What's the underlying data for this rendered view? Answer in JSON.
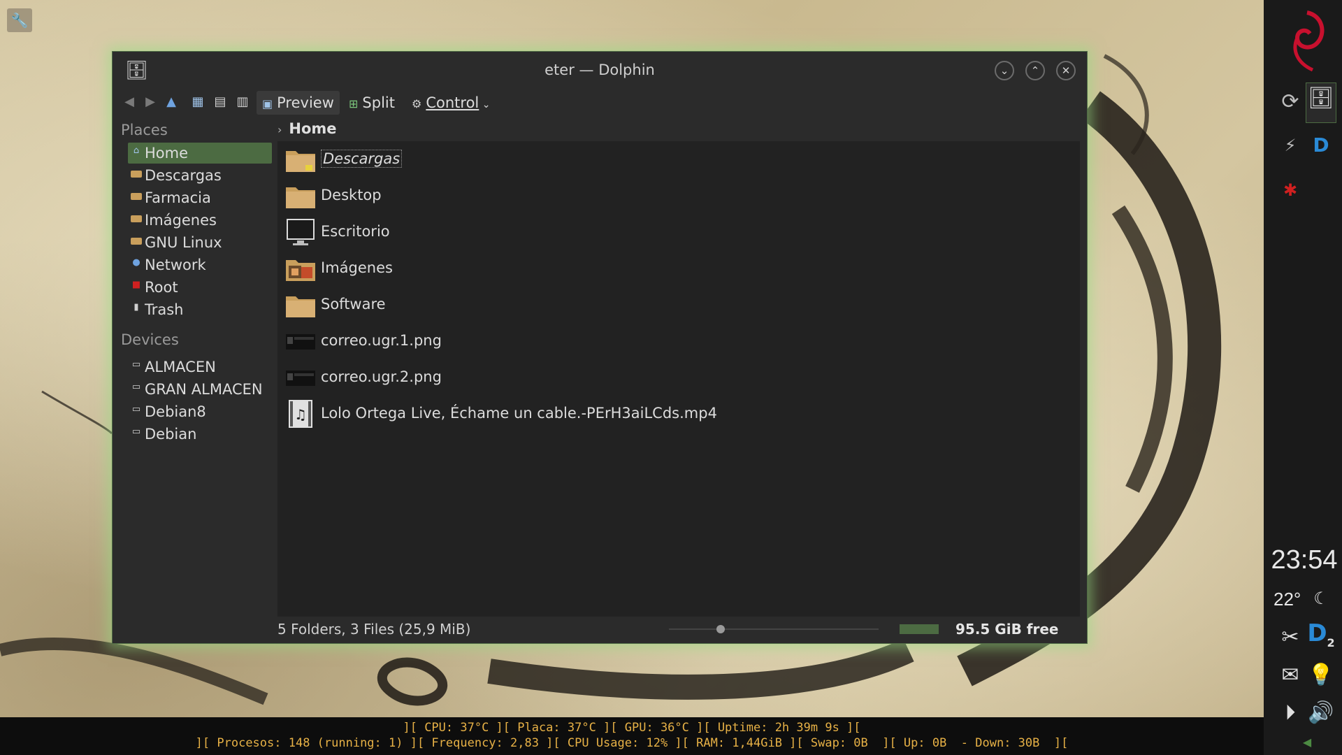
{
  "window": {
    "title": "eter — Dolphin"
  },
  "toolbar": {
    "preview_label": "Preview",
    "split_label": "Split",
    "control_label": "Control"
  },
  "places": {
    "title": "Places",
    "items": [
      {
        "label": "Home",
        "icon": "home-icon"
      },
      {
        "label": "Descargas",
        "icon": "folder-icon"
      },
      {
        "label": "Farmacia",
        "icon": "folder-icon"
      },
      {
        "label": "Imágenes",
        "icon": "folder-icon"
      },
      {
        "label": "GNU Linux",
        "icon": "folder-icon"
      },
      {
        "label": "Network",
        "icon": "network-icon"
      },
      {
        "label": "Root",
        "icon": "root-icon"
      },
      {
        "label": "Trash",
        "icon": "trash-icon"
      }
    ]
  },
  "devices": {
    "title": "Devices",
    "items": [
      {
        "label": "ALMACEN",
        "icon": "drive-icon"
      },
      {
        "label": "GRAN ALMACEN",
        "icon": "drive-icon"
      },
      {
        "label": "Debian8",
        "icon": "drive-icon"
      },
      {
        "label": "Debian",
        "icon": "drive-icon"
      }
    ]
  },
  "breadcrumb": {
    "current": "Home"
  },
  "files": [
    {
      "name": "Descargas",
      "icon": "folder-download-icon"
    },
    {
      "name": "Desktop",
      "icon": "folder-icon"
    },
    {
      "name": "Escritorio",
      "icon": "monitor-icon"
    },
    {
      "name": "Imágenes",
      "icon": "folder-pictures-icon"
    },
    {
      "name": "Software",
      "icon": "folder-icon"
    },
    {
      "name": "correo.ugr.1.png",
      "icon": "image-thumbnail-icon"
    },
    {
      "name": "correo.ugr.2.png",
      "icon": "image-thumbnail-icon"
    },
    {
      "name": "Lolo Ortega Live, Échame un cable.-PErH3aiLCds.mp4",
      "icon": "video-file-icon"
    }
  ],
  "status": {
    "summary": "5 Folders, 3 Files (25,9 MiB)",
    "free_space": "95.5 GiB free"
  },
  "panel": {
    "clock": "23:54",
    "temperature": "22°",
    "badge": "2"
  },
  "conky": {
    "line1": "][ CPU: 37°C ][ Placa: 37°C ][ GPU: 36°C ][ Uptime: 2h 39m 9s ][",
    "line2": "][ Procesos: 148 (running: 1) ][ Frequency: 2,83 ][ CPU Usage: 12% ][ RAM: 1,44GiB ][ Swap: 0B  ][ Up: 0B  - Down: 30B  ]["
  },
  "colors": {
    "accent": "#4c6b42",
    "glow": "#96dc82",
    "conky_text": "#e7b146"
  }
}
